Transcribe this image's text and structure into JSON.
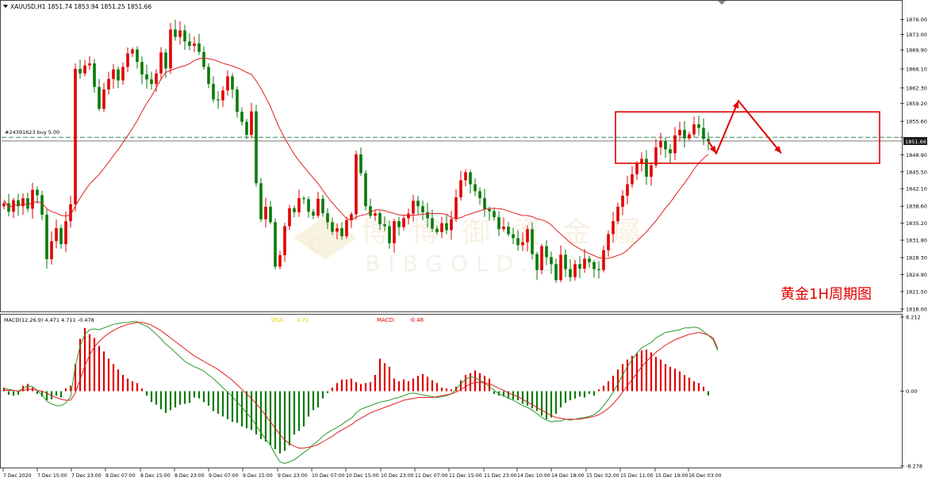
{
  "header": {
    "symbol_line": "XAUUSD,H1  1851.74 1853.94 1851.25 1851.66",
    "order_label": "#24391623 buy 5.00",
    "price_badge": "1851.66",
    "annotation": "黄金1H周期图",
    "watermark_cn": "博 博 御 資 金 屬",
    "watermark_en": "BIBGOLD.COM"
  },
  "macd_panel": {
    "title": "MACD(12,26,9) 4.471 4.711 -0.478",
    "osma_label": "OSA",
    "osma_value": "4.71",
    "macd_label": "MACD:",
    "macd_value": "-0.48"
  },
  "colors": {
    "bull": "#e00000",
    "bear": "#0a7a0a",
    "ma": "#e02020",
    "signal_green": "#2a9a2a",
    "hline": "#2e8b57",
    "annotation": "#e00000",
    "grid_border": "#444444"
  },
  "chart_data": [
    {
      "type": "candlestick",
      "name": "price",
      "ylim": [
        1818.0,
        1878.0
      ],
      "y_ticks": [
        "1876.00",
        "1873.00",
        "1869.90",
        "1866.10",
        "1862.30",
        "1859.20",
        "1855.60",
        "1852.40",
        "1848.90",
        "1845.50",
        "1842.10",
        "1838.60",
        "1835.20",
        "1831.80",
        "1828.30",
        "1824.90",
        "1821.50",
        "1818.00"
      ],
      "y_tick_values": [
        1876.0,
        1873.0,
        1869.9,
        1866.1,
        1862.3,
        1859.2,
        1855.6,
        1852.4,
        1848.9,
        1845.5,
        1842.1,
        1838.6,
        1835.2,
        1831.8,
        1828.3,
        1824.9,
        1821.5,
        1818.0
      ],
      "x_labels": [
        "7 Dec 2020",
        "7 Dec 15:00",
        "7 Dec 23:00",
        "8 Dec 07:00",
        "8 Dec 15:00",
        "8 Dec 23:00",
        "9 Dec 07:00",
        "9 Dec 15:00",
        "9 Dec 23:00",
        "10 Dec 07:00",
        "10 Dec 15:00",
        "10 Dec 23:00",
        "11 Dec 07:00",
        "11 Dec 15:00",
        "11 Dec 23:00",
        "14 Dec 10:00",
        "14 Dec 18:00",
        "15 Dec 02:00",
        "15 Dec 11:00",
        "15 Dec 19:00",
        "16 Dec 03:00"
      ],
      "current_price": 1851.66,
      "order_price": 1852.4,
      "highlight_box": {
        "from_index": 129,
        "to_index": 152,
        "low": 1847.2,
        "high": 1857.5
      },
      "path_points": [
        [
          1849.2,
          1857.2
        ],
        [
          1851.5,
          1859.7
        ],
        [
          1855.0,
          1849.2
        ]
      ],
      "closes": [
        1839.2,
        1837.5,
        1839.8,
        1838.6,
        1840.2,
        1838.1,
        1841.9,
        1840.8,
        1836.9,
        1828.0,
        1831.6,
        1834.2,
        1831.0,
        1835.6,
        1839.0,
        1866.1,
        1865.2,
        1866.8,
        1867.2,
        1862.5,
        1858.1,
        1862.0,
        1864.1,
        1866.0,
        1863.8,
        1866.5,
        1869.2,
        1870.0,
        1867.5,
        1865.0,
        1864.0,
        1863.1,
        1865.2,
        1869.4,
        1866.2,
        1874.0,
        1872.5,
        1873.8,
        1871.6,
        1870.7,
        1871.2,
        1869.5,
        1866.5,
        1863.1,
        1860.0,
        1859.8,
        1861.8,
        1864.6,
        1862.0,
        1857.5,
        1855.5,
        1852.9,
        1857.6,
        1843.2,
        1836.0,
        1838.5,
        1835.4,
        1826.5,
        1828.8,
        1834.6,
        1838.2,
        1837.4,
        1840.2,
        1840.0,
        1837.5,
        1836.7,
        1840.1,
        1837.2,
        1835.4,
        1833.5,
        1834.2,
        1832.6,
        1835.8,
        1837.0,
        1849.0,
        1845.2,
        1838.6,
        1836.7,
        1837.2,
        1835.0,
        1834.6,
        1831.2,
        1835.6,
        1834.4,
        1836.2,
        1837.1,
        1839.7,
        1838.6,
        1837.4,
        1836.2,
        1834.1,
        1833.4,
        1835.2,
        1833.8,
        1836.0,
        1840.4,
        1843.8,
        1845.4,
        1843.0,
        1841.6,
        1840.2,
        1838.0,
        1837.6,
        1836.4,
        1834.0,
        1834.5,
        1833.0,
        1832.2,
        1830.8,
        1831.4,
        1834.0,
        1829.0,
        1825.8,
        1830.6,
        1828.4,
        1827.0,
        1823.8,
        1828.9,
        1826.0,
        1824.4,
        1827.0,
        1826.1,
        1828.1,
        1827.4,
        1826.0,
        1825.8,
        1829.8,
        1833.0,
        1835.6,
        1838.5,
        1840.7,
        1843.0,
        1845.0,
        1847.2,
        1848.1,
        1844.5,
        1846.8,
        1850.4,
        1851.6,
        1850.0,
        1849.2,
        1852.8,
        1853.9,
        1852.2,
        1853.0,
        1855.0,
        1854.3,
        1852.1,
        1851.66
      ],
      "ma_start_value": 1839.9,
      "ma_end_value": 1842.8
    },
    {
      "type": "histogram",
      "name": "macd",
      "ylim": [
        -8.278,
        8.212
      ],
      "y_ticks": [
        "8.212",
        "0.00",
        "-8.278"
      ],
      "y_tick_values": [
        8.212,
        0.0,
        -8.278
      ],
      "histogram": [
        0.4,
        -0.4,
        -0.5,
        -0.4,
        0.6,
        0.8,
        0.4,
        -0.3,
        -0.6,
        -1.0,
        -0.9,
        -0.5,
        -0.7,
        0.3,
        0.6,
        3.0,
        5.8,
        7.0,
        6.3,
        5.9,
        5.0,
        4.4,
        3.6,
        3.0,
        2.4,
        1.8,
        1.4,
        1.1,
        0.9,
        0.3,
        -0.5,
        -1.2,
        -1.5,
        -2.0,
        -2.4,
        -2.1,
        -1.8,
        -1.5,
        -1.4,
        -1.3,
        -0.7,
        -0.8,
        -1.2,
        -1.6,
        -2.2,
        -2.5,
        -2.8,
        -3.1,
        -3.4,
        -3.5,
        -3.9,
        -4.1,
        -4.3,
        -4.8,
        -5.3,
        -5.6,
        -6.0,
        -6.4,
        -6.9,
        -6.6,
        -6.0,
        -4.8,
        -4.4,
        -3.9,
        -2.8,
        -2.1,
        -1.8,
        -0.8,
        -0.2,
        0.4,
        0.9,
        1.3,
        1.3,
        1.4,
        1.0,
        0.8,
        0.9,
        1.0,
        1.8,
        3.6,
        3.1,
        2.7,
        1.4,
        1.1,
        1.3,
        1.1,
        1.4,
        1.7,
        1.9,
        1.6,
        1.2,
        0.9,
        0.4,
        0.3,
        0.2,
        0.5,
        1.2,
        1.8,
        2.0,
        2.3,
        2.0,
        1.7,
        1.4,
        -0.3,
        -0.5,
        -0.6,
        -0.8,
        -0.9,
        -1.0,
        -1.4,
        -1.6,
        -1.9,
        -2.2,
        -2.7,
        -3.1,
        -2.9,
        -2.5,
        -1.8,
        -1.3,
        -1.0,
        -0.8,
        -0.6,
        -0.7,
        -0.3,
        -0.5,
        0.2,
        0.6,
        1.1,
        1.7,
        2.4,
        3.0,
        3.5,
        3.9,
        4.2,
        4.5,
        4.6,
        4.3,
        3.8,
        3.5,
        3.0,
        2.7,
        2.5,
        2.2,
        1.8,
        1.5,
        1.1,
        0.9,
        0.5,
        -0.48
      ],
      "macd_line": [
        0.3,
        0.2,
        0.1,
        0.0,
        0.3,
        0.6,
        0.5,
        0.1,
        -0.4,
        -1.1,
        -1.4,
        -1.6,
        -1.6,
        -1.3,
        -0.6,
        2.8,
        5.0,
        6.3,
        6.8,
        6.9,
        6.8,
        7.0,
        7.2,
        7.4,
        7.5,
        7.6,
        7.6,
        7.7,
        7.7,
        7.4,
        7.2,
        6.8,
        6.3,
        5.8,
        5.2,
        4.8,
        4.3,
        3.8,
        3.3,
        3.0,
        2.7,
        2.5,
        2.2,
        1.8,
        1.4,
        0.9,
        0.4,
        -0.1,
        -0.6,
        -1.2,
        -1.8,
        -2.4,
        -3.0,
        -3.8,
        -4.6,
        -5.3,
        -6.0,
        -7.0,
        -7.8,
        -8.0,
        -7.8,
        -7.6,
        -7.2,
        -6.8,
        -6.4,
        -5.9,
        -5.5,
        -5.0,
        -4.6,
        -4.3,
        -4.0,
        -3.7,
        -3.3,
        -3.0,
        -2.4,
        -2.0,
        -1.8,
        -1.6,
        -1.4,
        -1.2,
        -1.1,
        -1.0,
        -0.8,
        -0.7,
        -0.5,
        -0.3,
        -0.2,
        -0.3,
        -0.4,
        -0.5,
        -0.6,
        -0.7,
        -0.6,
        -0.5,
        -0.3,
        0.2,
        0.8,
        1.3,
        1.6,
        1.5,
        1.2,
        0.9,
        0.5,
        0.1,
        -0.3,
        -0.5,
        -0.8,
        -1.0,
        -1.3,
        -1.6,
        -1.8,
        -2.1,
        -2.5,
        -2.9,
        -3.2,
        -3.4,
        -3.3,
        -3.3,
        -3.1,
        -3.2,
        -3.1,
        -3.0,
        -2.9,
        -2.8,
        -2.6,
        -2.2,
        -1.6,
        -0.9,
        -0.1,
        0.8,
        1.8,
        2.7,
        3.5,
        4.2,
        4.8,
        5.1,
        5.4,
        5.9,
        6.2,
        6.5,
        6.6,
        6.7,
        6.8,
        7.0,
        7.0,
        7.1,
        7.0,
        6.6,
        6.2,
        5.7,
        4.47
      ],
      "signal_line": [
        0.1,
        0.1,
        0.1,
        0.0,
        0.1,
        0.2,
        0.2,
        0.1,
        0.0,
        -0.2,
        -0.5,
        -0.7,
        -0.9,
        -1.0,
        -1.0,
        -0.2,
        1.3,
        2.8,
        4.0,
        4.9,
        5.5,
        6.0,
        6.4,
        6.7,
        7.0,
        7.2,
        7.4,
        7.5,
        7.6,
        7.6,
        7.5,
        7.3,
        7.0,
        6.7,
        6.3,
        5.9,
        5.5,
        5.1,
        4.7,
        4.3,
        3.9,
        3.6,
        3.3,
        3.0,
        2.7,
        2.4,
        2.0,
        1.6,
        1.2,
        0.7,
        0.2,
        -0.3,
        -0.8,
        -1.4,
        -2.0,
        -2.7,
        -3.4,
        -4.1,
        -4.8,
        -5.4,
        -5.8,
        -6.1,
        -6.3,
        -6.3,
        -6.2,
        -6.1,
        -5.9,
        -5.6,
        -5.3,
        -5.0,
        -4.6,
        -4.3,
        -4.0,
        -3.7,
        -3.3,
        -3.0,
        -2.7,
        -2.4,
        -2.2,
        -2.0,
        -1.8,
        -1.6,
        -1.4,
        -1.2,
        -1.0,
        -0.9,
        -0.8,
        -0.7,
        -0.7,
        -0.7,
        -0.7,
        -0.6,
        -0.5,
        -0.4,
        -0.3,
        -0.1,
        0.2,
        0.5,
        0.8,
        1.0,
        1.0,
        0.9,
        0.8,
        0.6,
        0.3,
        0.1,
        -0.2,
        -0.4,
        -0.6,
        -0.9,
        -1.2,
        -1.5,
        -1.8,
        -2.1,
        -2.4,
        -2.7,
        -2.9,
        -3.0,
        -3.1,
        -3.1,
        -3.1,
        -3.1,
        -3.0,
        -2.9,
        -2.8,
        -2.6,
        -2.3,
        -1.9,
        -1.4,
        -0.8,
        -0.1,
        0.6,
        1.3,
        2.0,
        2.7,
        3.3,
        3.8,
        4.3,
        4.7,
        5.1,
        5.4,
        5.7,
        5.9,
        6.1,
        6.3,
        6.4,
        6.5,
        6.4,
        6.2,
        5.9,
        4.71
      ]
    }
  ]
}
